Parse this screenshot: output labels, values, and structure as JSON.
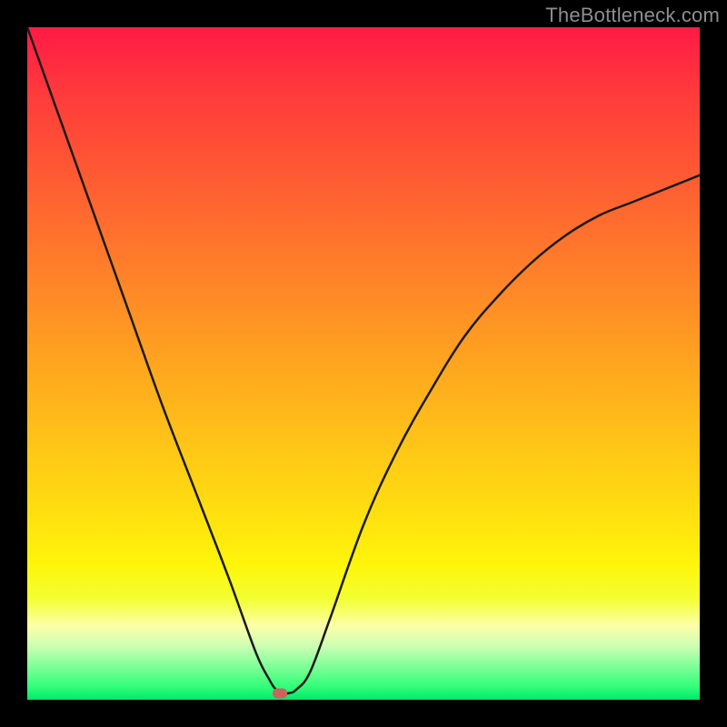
{
  "watermark": {
    "text": "TheBottleneck.com"
  },
  "chart_data": {
    "type": "line",
    "title": "",
    "xlabel": "",
    "ylabel": "",
    "xlim": [
      0,
      100
    ],
    "ylim": [
      0,
      100
    ],
    "grid": false,
    "series": [
      {
        "name": "bottleneck-curve",
        "x": [
          0,
          5,
          10,
          15,
          20,
          25,
          30,
          34,
          36,
          37,
          38,
          39,
          40,
          42,
          45,
          50,
          55,
          60,
          65,
          70,
          75,
          80,
          85,
          90,
          95,
          100
        ],
        "values": [
          100,
          86,
          72,
          58,
          44,
          31,
          18,
          7,
          3,
          1.5,
          1,
          1,
          1.5,
          4,
          12,
          26,
          37,
          46,
          54,
          60,
          65,
          69,
          72,
          74,
          76,
          78
        ]
      }
    ],
    "marker": {
      "x": 37.5,
      "y": 1,
      "label": "optimal-point"
    },
    "background_gradient": {
      "top": "#ff1a45",
      "mid": "#ffd911",
      "bottom": "#00e86b"
    }
  }
}
